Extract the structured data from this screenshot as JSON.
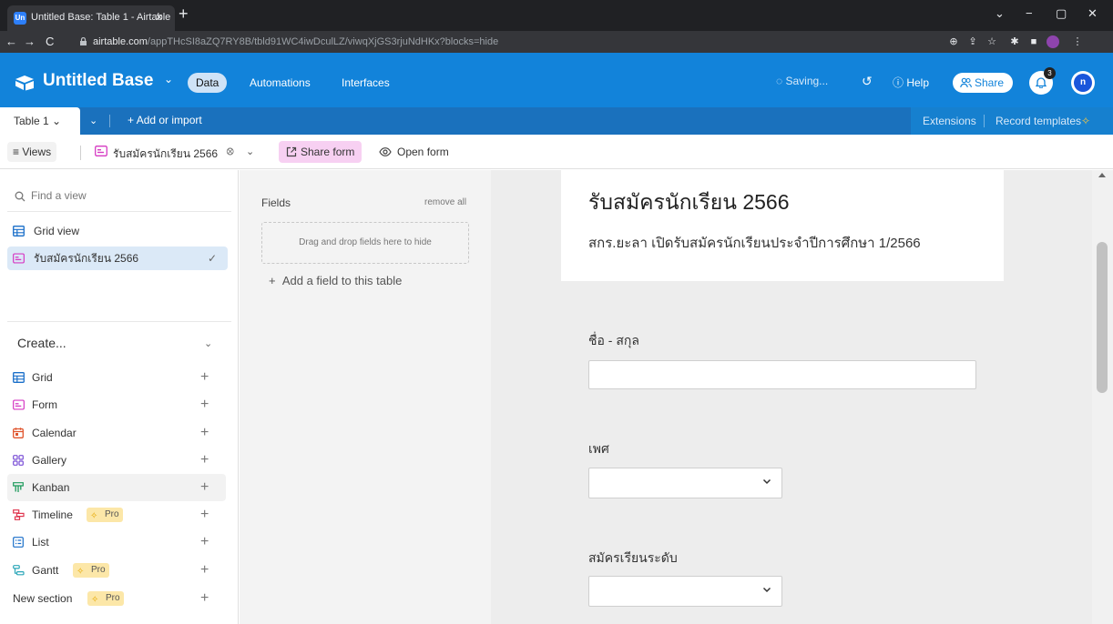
{
  "browser": {
    "tab_title": "Untitled Base: Table 1 - Airtable",
    "tab_close": "×",
    "new_tab": "+",
    "url_host": "airtable.com",
    "url_path": "/appTHcSI8aZQ7RY8B/tbld91WC4iwDculLZ/viwqXjGS3rjuNdHKx?blocks=hide",
    "window": {
      "minimize": "−",
      "restore": "▢",
      "close": "✕",
      "tabsearch": "⌄"
    }
  },
  "header": {
    "base_name": "Untitled Base",
    "tabs": {
      "data": "Data",
      "automations": "Automations",
      "interfaces": "Interfaces"
    },
    "saving": "Saving...",
    "help": "Help",
    "share": "Share",
    "notifications_count": "3",
    "avatar_initial": "n",
    "colors": {
      "primary": "#1283da",
      "table_bar": "#1a71bd"
    }
  },
  "tablebar": {
    "table_name": "Table 1",
    "add_or_import": "Add or import",
    "extensions": "Extensions",
    "record_templates": "Record templates"
  },
  "viewbar": {
    "views_label": "Views",
    "current_view": "รับสมัครนักเรียน 2566",
    "share_form": "Share form",
    "open_form": "Open form"
  },
  "sidebar": {
    "find_placeholder": "Find a view",
    "views": [
      {
        "label": "Grid view",
        "icon": "grid-icon"
      },
      {
        "label": "รับสมัครนักเรียน 2566",
        "icon": "form-icon",
        "selected": true
      }
    ],
    "create_label": "Create...",
    "create_items": [
      {
        "label": "Grid",
        "icon": "grid-icon"
      },
      {
        "label": "Form",
        "icon": "form-icon"
      },
      {
        "label": "Calendar",
        "icon": "calendar-icon"
      },
      {
        "label": "Gallery",
        "icon": "gallery-icon"
      },
      {
        "label": "Kanban",
        "icon": "kanban-icon"
      },
      {
        "label": "Timeline",
        "icon": "timeline-icon",
        "pro": "Pro"
      },
      {
        "label": "List",
        "icon": "list-icon"
      },
      {
        "label": "Gantt",
        "icon": "gantt-icon",
        "pro": "Pro"
      },
      {
        "label": "New section",
        "pro": "Pro"
      }
    ]
  },
  "fields_panel": {
    "title": "Fields",
    "remove_all": "remove all",
    "drop_hint": "Drag and drop fields here to hide",
    "add_field": "Add a field to this table"
  },
  "form": {
    "title": "รับสมัครนักเรียน 2566",
    "description": "สกร.ยะลา เปิดรับสมัครนักเรียนประจำปีการศึกษา 1/2566",
    "questions": [
      {
        "label": "ชื่อ - สกุล",
        "type": "text",
        "value": ""
      },
      {
        "label": "เพศ",
        "type": "select",
        "value": ""
      },
      {
        "label": "สมัครเรียนระดับ",
        "type": "select",
        "value": ""
      }
    ]
  }
}
